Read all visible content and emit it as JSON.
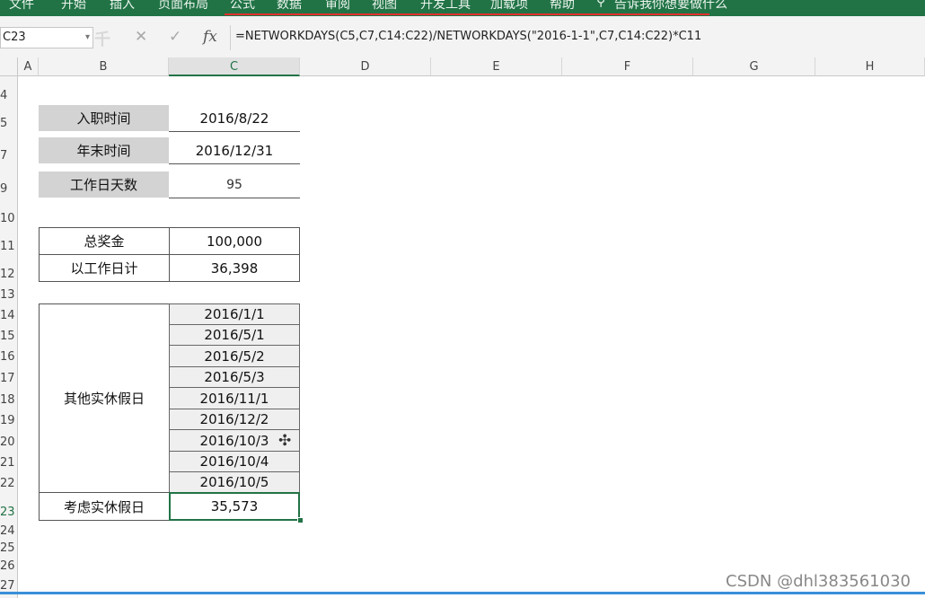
{
  "ribbon": {
    "tabs": [
      "文件",
      "开始",
      "插入",
      "页面布局",
      "公式",
      "数据",
      "审阅",
      "视图",
      "开发工具",
      "加载项",
      "帮助"
    ],
    "tell_me": "告诉我你想要做什么",
    "accent": "#217346"
  },
  "formula_bar": {
    "name_box": "C23",
    "cancel": "✕",
    "enter": "✓",
    "fx": "fx",
    "formula": "=NETWORKDAYS(C5,C7,C14:C22)/NETWORKDAYS(\"2016-1-1\",C7,C14:C22)*C11"
  },
  "columns": [
    "A",
    "B",
    "C",
    "D",
    "E",
    "F",
    "G",
    "H"
  ],
  "rows": [
    "4",
    "5",
    "7",
    "9",
    "10",
    "11",
    "12",
    "13",
    "14",
    "15",
    "16",
    "17",
    "18",
    "19",
    "20",
    "21",
    "22",
    "23",
    "24",
    "25",
    "26",
    "27"
  ],
  "cells": {
    "hire_label": "入职时间",
    "hire_value": "2016/8/22",
    "yearend_label": "年末时间",
    "yearend_value": "2016/12/31",
    "workdays_label": "工作日天数",
    "workdays_value": "95",
    "bonus_label": "总奖金",
    "bonus_value": "100,000",
    "by_workday_label": "以工作日计",
    "by_workday_value": "36,398",
    "holidays_label": "其他实休假日",
    "holidays": [
      "2016/1/1",
      "2016/5/1",
      "2016/5/2",
      "2016/5/3",
      "2016/11/1",
      "2016/12/2",
      "2016/10/3",
      "2016/10/4",
      "2016/10/5"
    ],
    "consider_label": "考虑实休假日",
    "consider_value": "35,573"
  },
  "watermark": "CSDN @dhl383561030"
}
